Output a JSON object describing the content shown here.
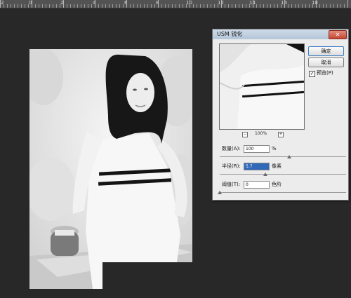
{
  "ruler": {
    "labels": [
      "2",
      "0",
      "2",
      "4",
      "6",
      "8",
      "10",
      "12",
      "14",
      "16",
      "18"
    ]
  },
  "dialog": {
    "title": "USM 锐化",
    "close_icon": "close-icon",
    "ok_label": "确定",
    "cancel_label": "取消",
    "preview_checked": true,
    "preview_label": "预览(P)",
    "zoom_level": "100%",
    "zoom_out_icon": "minus-icon",
    "zoom_in_icon": "plus-icon",
    "amount": {
      "label": "数量(A):",
      "value": "100",
      "unit": "%",
      "slider": 0.55
    },
    "radius": {
      "label": "半径(R):",
      "value": "5.7",
      "unit": "像素",
      "slider": 0.36
    },
    "threshold": {
      "label": "阈值(T):",
      "value": "0",
      "unit": "色阶",
      "slider": 0.0
    }
  },
  "colors": {
    "app_background": "#282828",
    "ruler": "#535353",
    "dialog_background": "#ececec",
    "title_bar": "#c4d3e3",
    "selection": "#3168b8"
  }
}
